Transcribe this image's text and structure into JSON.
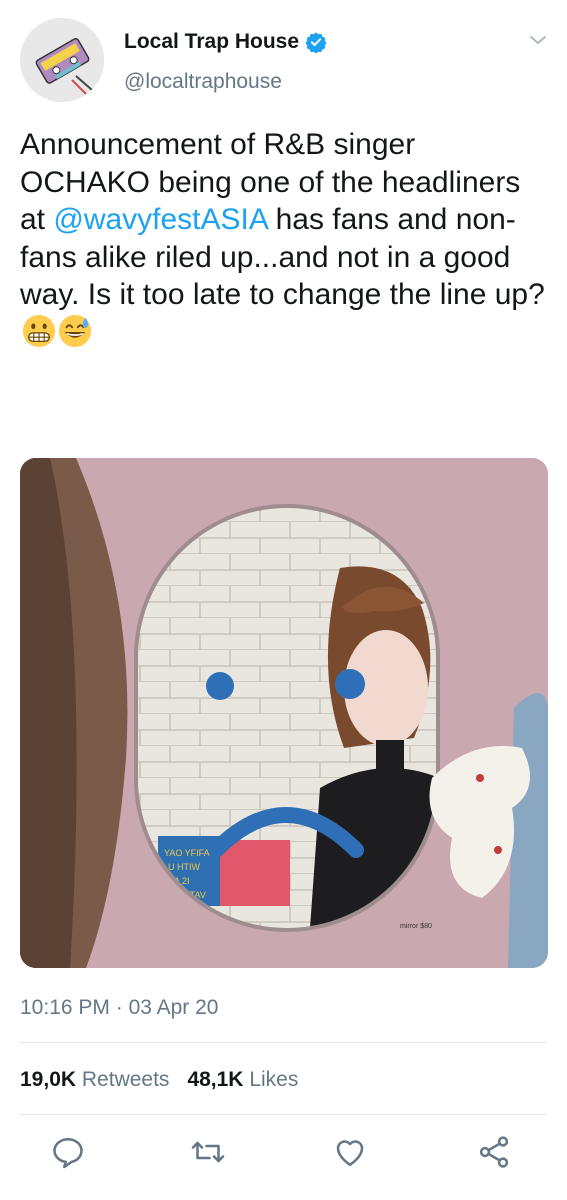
{
  "author": {
    "display_name": "Local Trap House",
    "handle": "@localtraphouse",
    "verified": true
  },
  "tweet": {
    "text_before": "Announcement of R&B singer OCHAKO being one of the headliners at ",
    "mention": "@wavyfestASIA",
    "text_after": " has fans and non-fans alike riled up...and not in a good way. Is it too late to change the line up? ",
    "emojis": [
      "grimacing-face-emoji",
      "grinning-sweat-emoji"
    ]
  },
  "media": {
    "poster_text": "YAO YFIFA U HTIW A 21 YOITATAV",
    "price_tag": "mirror $80"
  },
  "meta": {
    "time": "10:16 PM",
    "separator": "·",
    "date": "03 Apr 20"
  },
  "stats": {
    "retweets_count": "19,0K",
    "retweets_label": "Retweets",
    "likes_count": "48,1K",
    "likes_label": "Likes"
  },
  "icons": {
    "reply": "reply-icon",
    "retweet": "retweet-icon",
    "like": "heart-icon",
    "share": "share-icon"
  },
  "colors": {
    "link": "#1da1f2",
    "secondary_text": "#657786",
    "verified": "#1da1f2"
  }
}
